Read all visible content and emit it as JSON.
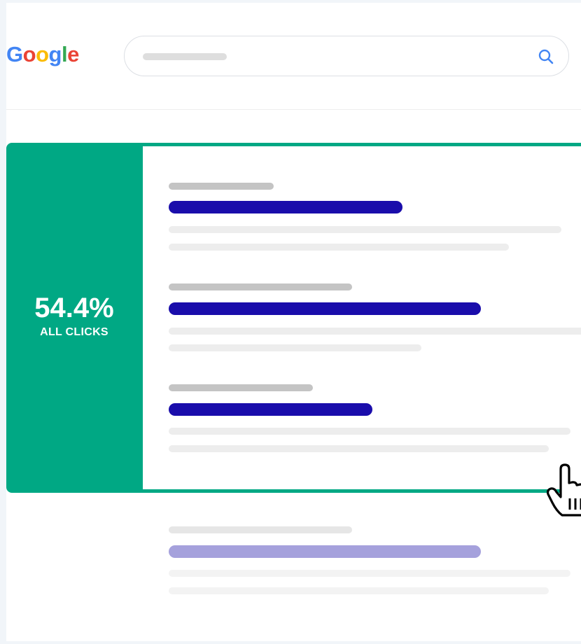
{
  "logo": {
    "letters": [
      "G",
      "o",
      "o",
      "g",
      "l",
      "e"
    ],
    "colors": [
      "#4285F4",
      "#EA4335",
      "#FBBC05",
      "#4285F4",
      "#34A853",
      "#EA4335"
    ]
  },
  "search": {
    "icon": "search-icon",
    "icon_color": "#4285F4"
  },
  "highlight": {
    "value": "54.4%",
    "label": "ALL CLICKS",
    "color": "#00A884"
  },
  "results": [
    {
      "highlighted": true
    },
    {
      "highlighted": true
    },
    {
      "highlighted": true
    },
    {
      "highlighted": false
    }
  ],
  "cursor": {
    "icon": "pointer-hand-icon"
  },
  "colors": {
    "title_link": "#1A0DAB",
    "url_gray": "#C4C4C4",
    "snippet_gray": "#EDEDED"
  }
}
